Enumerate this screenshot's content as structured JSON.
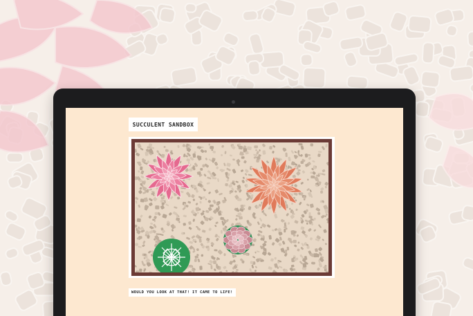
{
  "app": {
    "title": "SUCCULENT SANDBOX",
    "caption": "WOULD YOU LOOK AT THAT! IT CAME TO LIFE!"
  },
  "colors": {
    "page_background": "#f6efe9",
    "screen_background": "#fde8d0",
    "sandbox_border": "#6b3a35",
    "sand": "#e9d9c7",
    "pebble": "#c9b8a6",
    "pink_succulent": "#e5698f",
    "orange_succulent": "#e07a5a",
    "green_succulent": "#2f9a55",
    "rosette_succulent": "#c98a93"
  },
  "succulents": [
    {
      "name": "pink-succulent",
      "icon": "pink-star-succulent-icon"
    },
    {
      "name": "orange-succulent",
      "icon": "orange-star-succulent-icon"
    },
    {
      "name": "rosette-succulent",
      "icon": "rosette-succulent-icon"
    },
    {
      "name": "green-succulent",
      "icon": "green-round-succulent-icon"
    }
  ]
}
